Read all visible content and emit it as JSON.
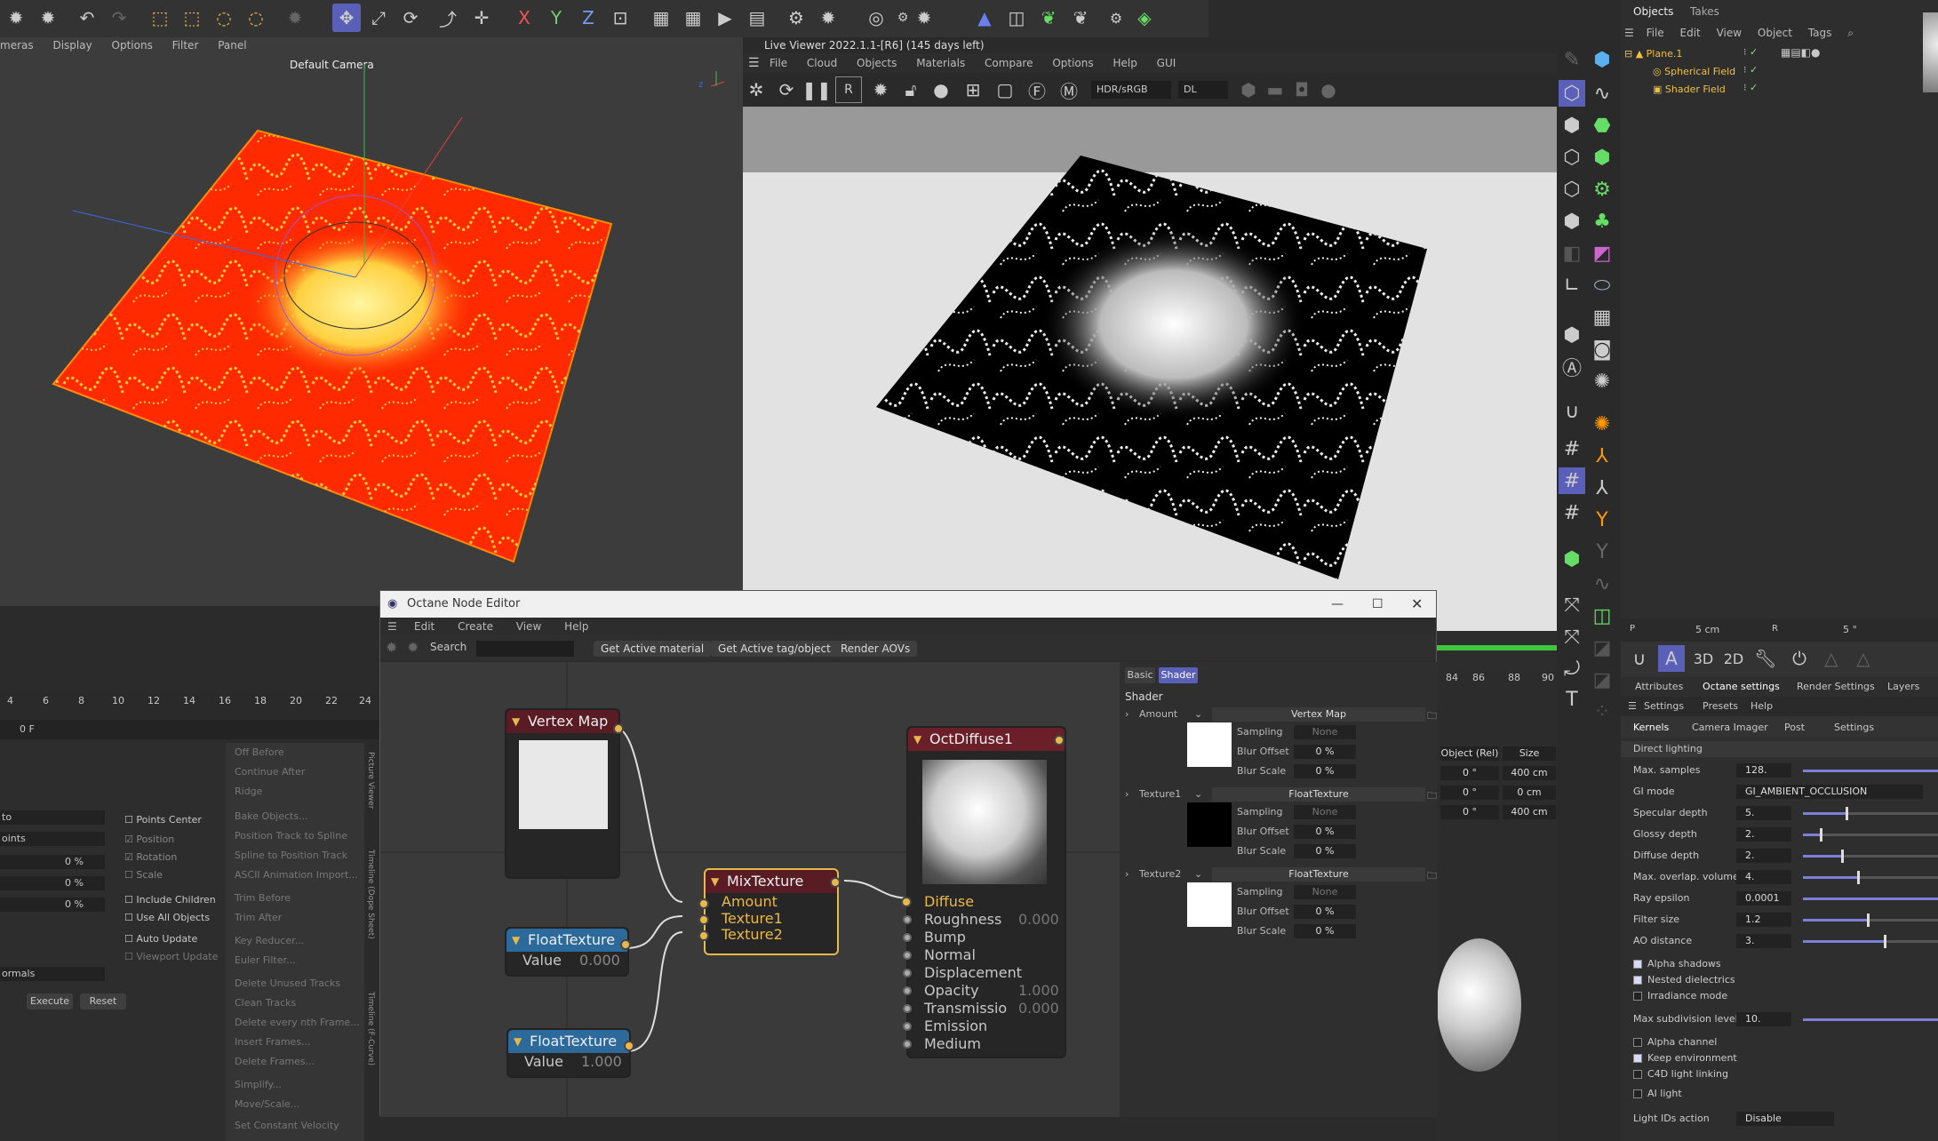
{
  "top_toolbar": {
    "axis_x": "X",
    "axis_y": "Y",
    "axis_z": "Z"
  },
  "viewport": {
    "menu": [
      "meras",
      "Display",
      "Options",
      "Filter",
      "Panel"
    ],
    "camera": "Default Camera"
  },
  "live_viewer": {
    "title": "Live Viewer 2022.1.1-[R6] (145 days left)",
    "menu": [
      "File",
      "Cloud",
      "Objects",
      "Materials",
      "Compare",
      "Options",
      "Help",
      "GUI"
    ],
    "color_space": "HDR/sRGB",
    "kernel": "DL"
  },
  "timeline": {
    "ticks": [
      "4",
      "6",
      "8",
      "10",
      "12",
      "14",
      "16",
      "18",
      "20",
      "22",
      "24"
    ],
    "frame": "0 F",
    "right_ticks": [
      "84",
      "86",
      "88",
      "90"
    ]
  },
  "attr_left": {
    "points_center": "Points Center",
    "position": "Position",
    "rotation": "Rotation",
    "scale": "Scale",
    "include_children": "Include Children",
    "use_all_objects": "Use All Objects",
    "auto_update": "Auto Update",
    "viewport_update": "Viewport Update",
    "pct1": "0 %",
    "pct2": "0 %",
    "pct3": "0 %",
    "select1": "to",
    "select2": "oints",
    "select3": "ormals",
    "execute": "Execute",
    "reset": "Reset"
  },
  "anim_menu": [
    "Off Before",
    "Continue After",
    "Ridge",
    "Bake Objects...",
    "Position Track to Spline",
    "Spline to Position Track",
    "ASCII Animation Import...",
    "Trim Before",
    "Trim After",
    "Key Reducer...",
    "Euler Filter...",
    "Delete Unused Tracks",
    "Clean Tracks",
    "Delete every nth Frame...",
    "Insert Frames...",
    "Delete Frames...",
    "Simplify...",
    "Move/Scale...",
    "Set Constant Velocity"
  ],
  "side_tabs": [
    "Picture Viewer",
    "Timeline (Dope Sheet)",
    "Timeline (F-Curve)"
  ],
  "node_editor": {
    "title": "Octane Node Editor",
    "menu": [
      "Edit",
      "Create",
      "View",
      "Help"
    ],
    "search_label": "Search",
    "buttons": [
      "Get Active material",
      "Get Active tag/object",
      "Render AOVs"
    ],
    "nodes": {
      "vertex_map": "Vertex Map",
      "float1": {
        "title": "FloatTexture",
        "label": "Value",
        "value": "0.000"
      },
      "float2": {
        "title": "FloatTexture",
        "label": "Value",
        "value": "1.000"
      },
      "mix": {
        "title": "MixTexture",
        "pins": [
          "Amount",
          "Texture1",
          "Texture2"
        ]
      },
      "diffuse": {
        "title": "OctDiffuse1",
        "pins": [
          {
            "name": "Diffuse",
            "value": ""
          },
          {
            "name": "Roughness",
            "value": "0.000"
          },
          {
            "name": "Bump",
            "value": ""
          },
          {
            "name": "Normal",
            "value": ""
          },
          {
            "name": "Displacement",
            "value": ""
          },
          {
            "name": "Opacity",
            "value": "1.000"
          },
          {
            "name": "Transmissio",
            "value": "0.000"
          },
          {
            "name": "Emission",
            "value": ""
          },
          {
            "name": "Medium",
            "value": ""
          }
        ]
      }
    },
    "inspector": {
      "tabs": [
        "Basic",
        "Shader"
      ],
      "heading": "Shader",
      "groups": [
        {
          "name": "Amount",
          "type": "Vertex Map",
          "sampling_label": "Sampling",
          "sampling": "None",
          "blur_offset_label": "Blur Offset",
          "blur_offset": "0 %",
          "blur_scale_label": "Blur Scale",
          "blur_scale": "0 %",
          "swatch": "#ffffff"
        },
        {
          "name": "Texture1",
          "type": "FloatTexture",
          "sampling_label": "Sampling",
          "sampling": "None",
          "blur_offset_label": "Blur Offset",
          "blur_offset": "0 %",
          "blur_scale_label": "Blur Scale",
          "blur_scale": "0 %",
          "swatch": "#000000"
        },
        {
          "name": "Texture2",
          "type": "FloatTexture",
          "sampling_label": "Sampling",
          "sampling": "None",
          "blur_offset_label": "Blur Offset",
          "blur_offset": "0 %",
          "blur_scale_label": "Blur Scale",
          "blur_scale": "0 %",
          "swatch": "#ffffff"
        }
      ]
    }
  },
  "objects_panel": {
    "tabs": [
      "Objects",
      "Takes"
    ],
    "menu": [
      "File",
      "Edit",
      "View",
      "Object",
      "Tags"
    ],
    "items": [
      "Plane.1",
      "Spherical Field",
      "Shader Field"
    ]
  },
  "coords": {
    "p_label": "P",
    "p_val": "5 cm",
    "r_label": "R",
    "r_val": "5 °",
    "mode": "Object (Rel)",
    "size_label": "Size",
    "rows": [
      [
        "0 °",
        "400 cm"
      ],
      [
        "0 °",
        "0 cm"
      ],
      [
        "0 °",
        "400 cm"
      ]
    ]
  },
  "settings": {
    "tabs": [
      "Attributes",
      "Octane settings",
      "Render Settings",
      "Layers"
    ],
    "menu": [
      "Settings",
      "Presets",
      "Help"
    ],
    "subtabs": [
      "Kernels",
      "Camera Imager",
      "Post",
      "Settings"
    ],
    "section": "Direct lighting",
    "params": [
      {
        "label": "Max. samples",
        "value": "128."
      },
      {
        "label": "GI mode",
        "value": "GI_AMBIENT_OCCLUSION"
      },
      {
        "label": "Specular depth",
        "value": "5.",
        "fill": 0.3
      },
      {
        "label": "Glossy depth",
        "value": "2.",
        "fill": 0.12
      },
      {
        "label": "Diffuse depth",
        "value": "2.",
        "fill": 0.27
      },
      {
        "label": "Max. overlap. volumes",
        "value": "4.",
        "fill": 0.38
      },
      {
        "label": "Ray epsilon",
        "value": "0.0001"
      },
      {
        "label": "Filter size",
        "value": "1.2",
        "fill": 0.45
      },
      {
        "label": "AO distance",
        "value": "3.",
        "fill": 0.57
      }
    ],
    "checks": [
      {
        "label": "Alpha shadows",
        "on": true
      },
      {
        "label": "Nested dielectrics",
        "on": true
      },
      {
        "label": "Irradiance mode",
        "on": false
      }
    ],
    "max_subdiv": {
      "label": "Max subdivision level",
      "value": "10."
    },
    "checks2": [
      {
        "label": "Alpha channel",
        "on": false
      },
      {
        "label": "Keep environment",
        "on": true
      },
      {
        "label": "C4D light linking",
        "on": false
      },
      {
        "label": "AI light",
        "on": false
      }
    ],
    "light_ids": {
      "label": "Light IDs action",
      "value": "Disable"
    }
  },
  "colors": {
    "accent": "#7b7fd8",
    "node_yellow": "#e8b84a",
    "node_red": "#8a2b34",
    "node_blue": "#2d6a9c"
  }
}
